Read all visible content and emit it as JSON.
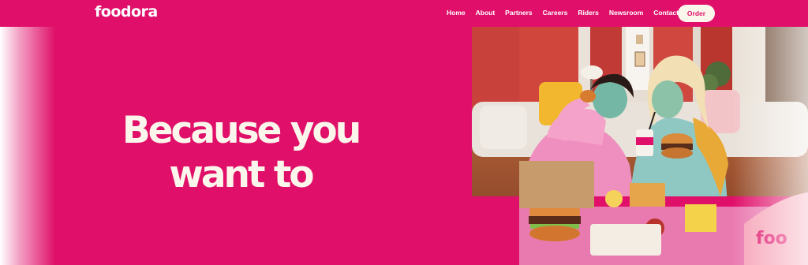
{
  "header": {
    "logo": "foodora",
    "nav": [
      "Home",
      "About",
      "Partners",
      "Careers",
      "Riders",
      "Newsroom",
      "Contact"
    ],
    "order_label": "Order"
  },
  "hero": {
    "headline_line1": "Because you",
    "headline_line2": "want to",
    "photo_alt": "",
    "box_brand_text": "foo"
  },
  "colors": {
    "brand_pink": "#e0106a",
    "cream": "#fbf6ec"
  }
}
